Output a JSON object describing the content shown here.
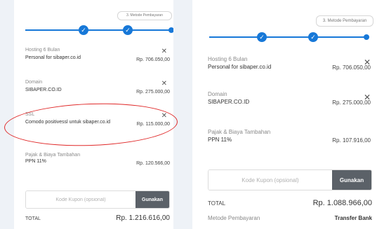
{
  "left": {
    "step_badge": "3. Metode Pembayaran",
    "items": [
      {
        "label": "Hosting 6 Bulan",
        "name": "Personal for sibaper.co.id",
        "price": "Rp. 706.050,00",
        "removable": true
      },
      {
        "label": "Domain",
        "name": "SIBAPER.CO.ID",
        "price": "Rp. 275.000,00",
        "removable": true
      },
      {
        "label": "SSL",
        "name": "Comodo positivessl untuk sibaper.co.id",
        "price": "Rp. 115.000,00",
        "removable": true
      },
      {
        "label": "Pajak & Biaya Tambahan",
        "name": "PPN 11%",
        "price": "Rp. 120.566,00",
        "removable": false
      }
    ],
    "coupon": {
      "placeholder": "Kode Kupon (opsional)",
      "button": "Gunakan"
    },
    "total": {
      "label": "TOTAL",
      "value": "Rp. 1.216.616,00"
    }
  },
  "right": {
    "step_badge": "3. Metode Pembayaran",
    "items": [
      {
        "label": "Hosting 6 Bulan",
        "name": "Personal for sibaper.co.id",
        "price": "Rp. 706.050,00",
        "removable": true
      },
      {
        "label": "Domain",
        "name": "SIBAPER.CO.ID",
        "price": "Rp. 275.000,00",
        "removable": true
      },
      {
        "label": "Pajak & Biaya Tambahan",
        "name": "PPN 11%",
        "price": "Rp. 107.916,00",
        "removable": false
      }
    ],
    "coupon": {
      "placeholder": "Kode Kupon (opsional)",
      "button": "Gunakan"
    },
    "total": {
      "label": "TOTAL",
      "value": "Rp. 1.088.966,00"
    },
    "payment_method": {
      "label": "Metode Pembayaran",
      "value": "Transfer Bank"
    }
  },
  "icons": {
    "check": "check-icon",
    "remove": "close-icon"
  },
  "colors": {
    "accent": "#1778d8",
    "button": "#5b6168",
    "highlight": "#e02828"
  }
}
